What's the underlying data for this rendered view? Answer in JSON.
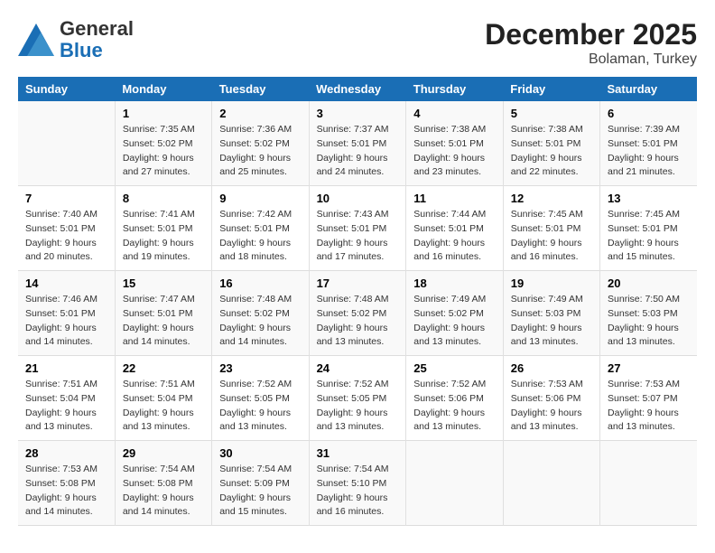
{
  "header": {
    "logo_general": "General",
    "logo_blue": "Blue",
    "month_year": "December 2025",
    "location": "Bolaman, Turkey"
  },
  "weekdays": [
    "Sunday",
    "Monday",
    "Tuesday",
    "Wednesday",
    "Thursday",
    "Friday",
    "Saturday"
  ],
  "weeks": [
    [
      {
        "day": "",
        "sunrise": "",
        "sunset": "",
        "daylight": ""
      },
      {
        "day": "1",
        "sunrise": "Sunrise: 7:35 AM",
        "sunset": "Sunset: 5:02 PM",
        "daylight": "Daylight: 9 hours and 27 minutes."
      },
      {
        "day": "2",
        "sunrise": "Sunrise: 7:36 AM",
        "sunset": "Sunset: 5:02 PM",
        "daylight": "Daylight: 9 hours and 25 minutes."
      },
      {
        "day": "3",
        "sunrise": "Sunrise: 7:37 AM",
        "sunset": "Sunset: 5:01 PM",
        "daylight": "Daylight: 9 hours and 24 minutes."
      },
      {
        "day": "4",
        "sunrise": "Sunrise: 7:38 AM",
        "sunset": "Sunset: 5:01 PM",
        "daylight": "Daylight: 9 hours and 23 minutes."
      },
      {
        "day": "5",
        "sunrise": "Sunrise: 7:38 AM",
        "sunset": "Sunset: 5:01 PM",
        "daylight": "Daylight: 9 hours and 22 minutes."
      },
      {
        "day": "6",
        "sunrise": "Sunrise: 7:39 AM",
        "sunset": "Sunset: 5:01 PM",
        "daylight": "Daylight: 9 hours and 21 minutes."
      }
    ],
    [
      {
        "day": "7",
        "sunrise": "Sunrise: 7:40 AM",
        "sunset": "Sunset: 5:01 PM",
        "daylight": "Daylight: 9 hours and 20 minutes."
      },
      {
        "day": "8",
        "sunrise": "Sunrise: 7:41 AM",
        "sunset": "Sunset: 5:01 PM",
        "daylight": "Daylight: 9 hours and 19 minutes."
      },
      {
        "day": "9",
        "sunrise": "Sunrise: 7:42 AM",
        "sunset": "Sunset: 5:01 PM",
        "daylight": "Daylight: 9 hours and 18 minutes."
      },
      {
        "day": "10",
        "sunrise": "Sunrise: 7:43 AM",
        "sunset": "Sunset: 5:01 PM",
        "daylight": "Daylight: 9 hours and 17 minutes."
      },
      {
        "day": "11",
        "sunrise": "Sunrise: 7:44 AM",
        "sunset": "Sunset: 5:01 PM",
        "daylight": "Daylight: 9 hours and 16 minutes."
      },
      {
        "day": "12",
        "sunrise": "Sunrise: 7:45 AM",
        "sunset": "Sunset: 5:01 PM",
        "daylight": "Daylight: 9 hours and 16 minutes."
      },
      {
        "day": "13",
        "sunrise": "Sunrise: 7:45 AM",
        "sunset": "Sunset: 5:01 PM",
        "daylight": "Daylight: 9 hours and 15 minutes."
      }
    ],
    [
      {
        "day": "14",
        "sunrise": "Sunrise: 7:46 AM",
        "sunset": "Sunset: 5:01 PM",
        "daylight": "Daylight: 9 hours and 14 minutes."
      },
      {
        "day": "15",
        "sunrise": "Sunrise: 7:47 AM",
        "sunset": "Sunset: 5:01 PM",
        "daylight": "Daylight: 9 hours and 14 minutes."
      },
      {
        "day": "16",
        "sunrise": "Sunrise: 7:48 AM",
        "sunset": "Sunset: 5:02 PM",
        "daylight": "Daylight: 9 hours and 14 minutes."
      },
      {
        "day": "17",
        "sunrise": "Sunrise: 7:48 AM",
        "sunset": "Sunset: 5:02 PM",
        "daylight": "Daylight: 9 hours and 13 minutes."
      },
      {
        "day": "18",
        "sunrise": "Sunrise: 7:49 AM",
        "sunset": "Sunset: 5:02 PM",
        "daylight": "Daylight: 9 hours and 13 minutes."
      },
      {
        "day": "19",
        "sunrise": "Sunrise: 7:49 AM",
        "sunset": "Sunset: 5:03 PM",
        "daylight": "Daylight: 9 hours and 13 minutes."
      },
      {
        "day": "20",
        "sunrise": "Sunrise: 7:50 AM",
        "sunset": "Sunset: 5:03 PM",
        "daylight": "Daylight: 9 hours and 13 minutes."
      }
    ],
    [
      {
        "day": "21",
        "sunrise": "Sunrise: 7:51 AM",
        "sunset": "Sunset: 5:04 PM",
        "daylight": "Daylight: 9 hours and 13 minutes."
      },
      {
        "day": "22",
        "sunrise": "Sunrise: 7:51 AM",
        "sunset": "Sunset: 5:04 PM",
        "daylight": "Daylight: 9 hours and 13 minutes."
      },
      {
        "day": "23",
        "sunrise": "Sunrise: 7:52 AM",
        "sunset": "Sunset: 5:05 PM",
        "daylight": "Daylight: 9 hours and 13 minutes."
      },
      {
        "day": "24",
        "sunrise": "Sunrise: 7:52 AM",
        "sunset": "Sunset: 5:05 PM",
        "daylight": "Daylight: 9 hours and 13 minutes."
      },
      {
        "day": "25",
        "sunrise": "Sunrise: 7:52 AM",
        "sunset": "Sunset: 5:06 PM",
        "daylight": "Daylight: 9 hours and 13 minutes."
      },
      {
        "day": "26",
        "sunrise": "Sunrise: 7:53 AM",
        "sunset": "Sunset: 5:06 PM",
        "daylight": "Daylight: 9 hours and 13 minutes."
      },
      {
        "day": "27",
        "sunrise": "Sunrise: 7:53 AM",
        "sunset": "Sunset: 5:07 PM",
        "daylight": "Daylight: 9 hours and 13 minutes."
      }
    ],
    [
      {
        "day": "28",
        "sunrise": "Sunrise: 7:53 AM",
        "sunset": "Sunset: 5:08 PM",
        "daylight": "Daylight: 9 hours and 14 minutes."
      },
      {
        "day": "29",
        "sunrise": "Sunrise: 7:54 AM",
        "sunset": "Sunset: 5:08 PM",
        "daylight": "Daylight: 9 hours and 14 minutes."
      },
      {
        "day": "30",
        "sunrise": "Sunrise: 7:54 AM",
        "sunset": "Sunset: 5:09 PM",
        "daylight": "Daylight: 9 hours and 15 minutes."
      },
      {
        "day": "31",
        "sunrise": "Sunrise: 7:54 AM",
        "sunset": "Sunset: 5:10 PM",
        "daylight": "Daylight: 9 hours and 16 minutes."
      },
      {
        "day": "",
        "sunrise": "",
        "sunset": "",
        "daylight": ""
      },
      {
        "day": "",
        "sunrise": "",
        "sunset": "",
        "daylight": ""
      },
      {
        "day": "",
        "sunrise": "",
        "sunset": "",
        "daylight": ""
      }
    ]
  ]
}
